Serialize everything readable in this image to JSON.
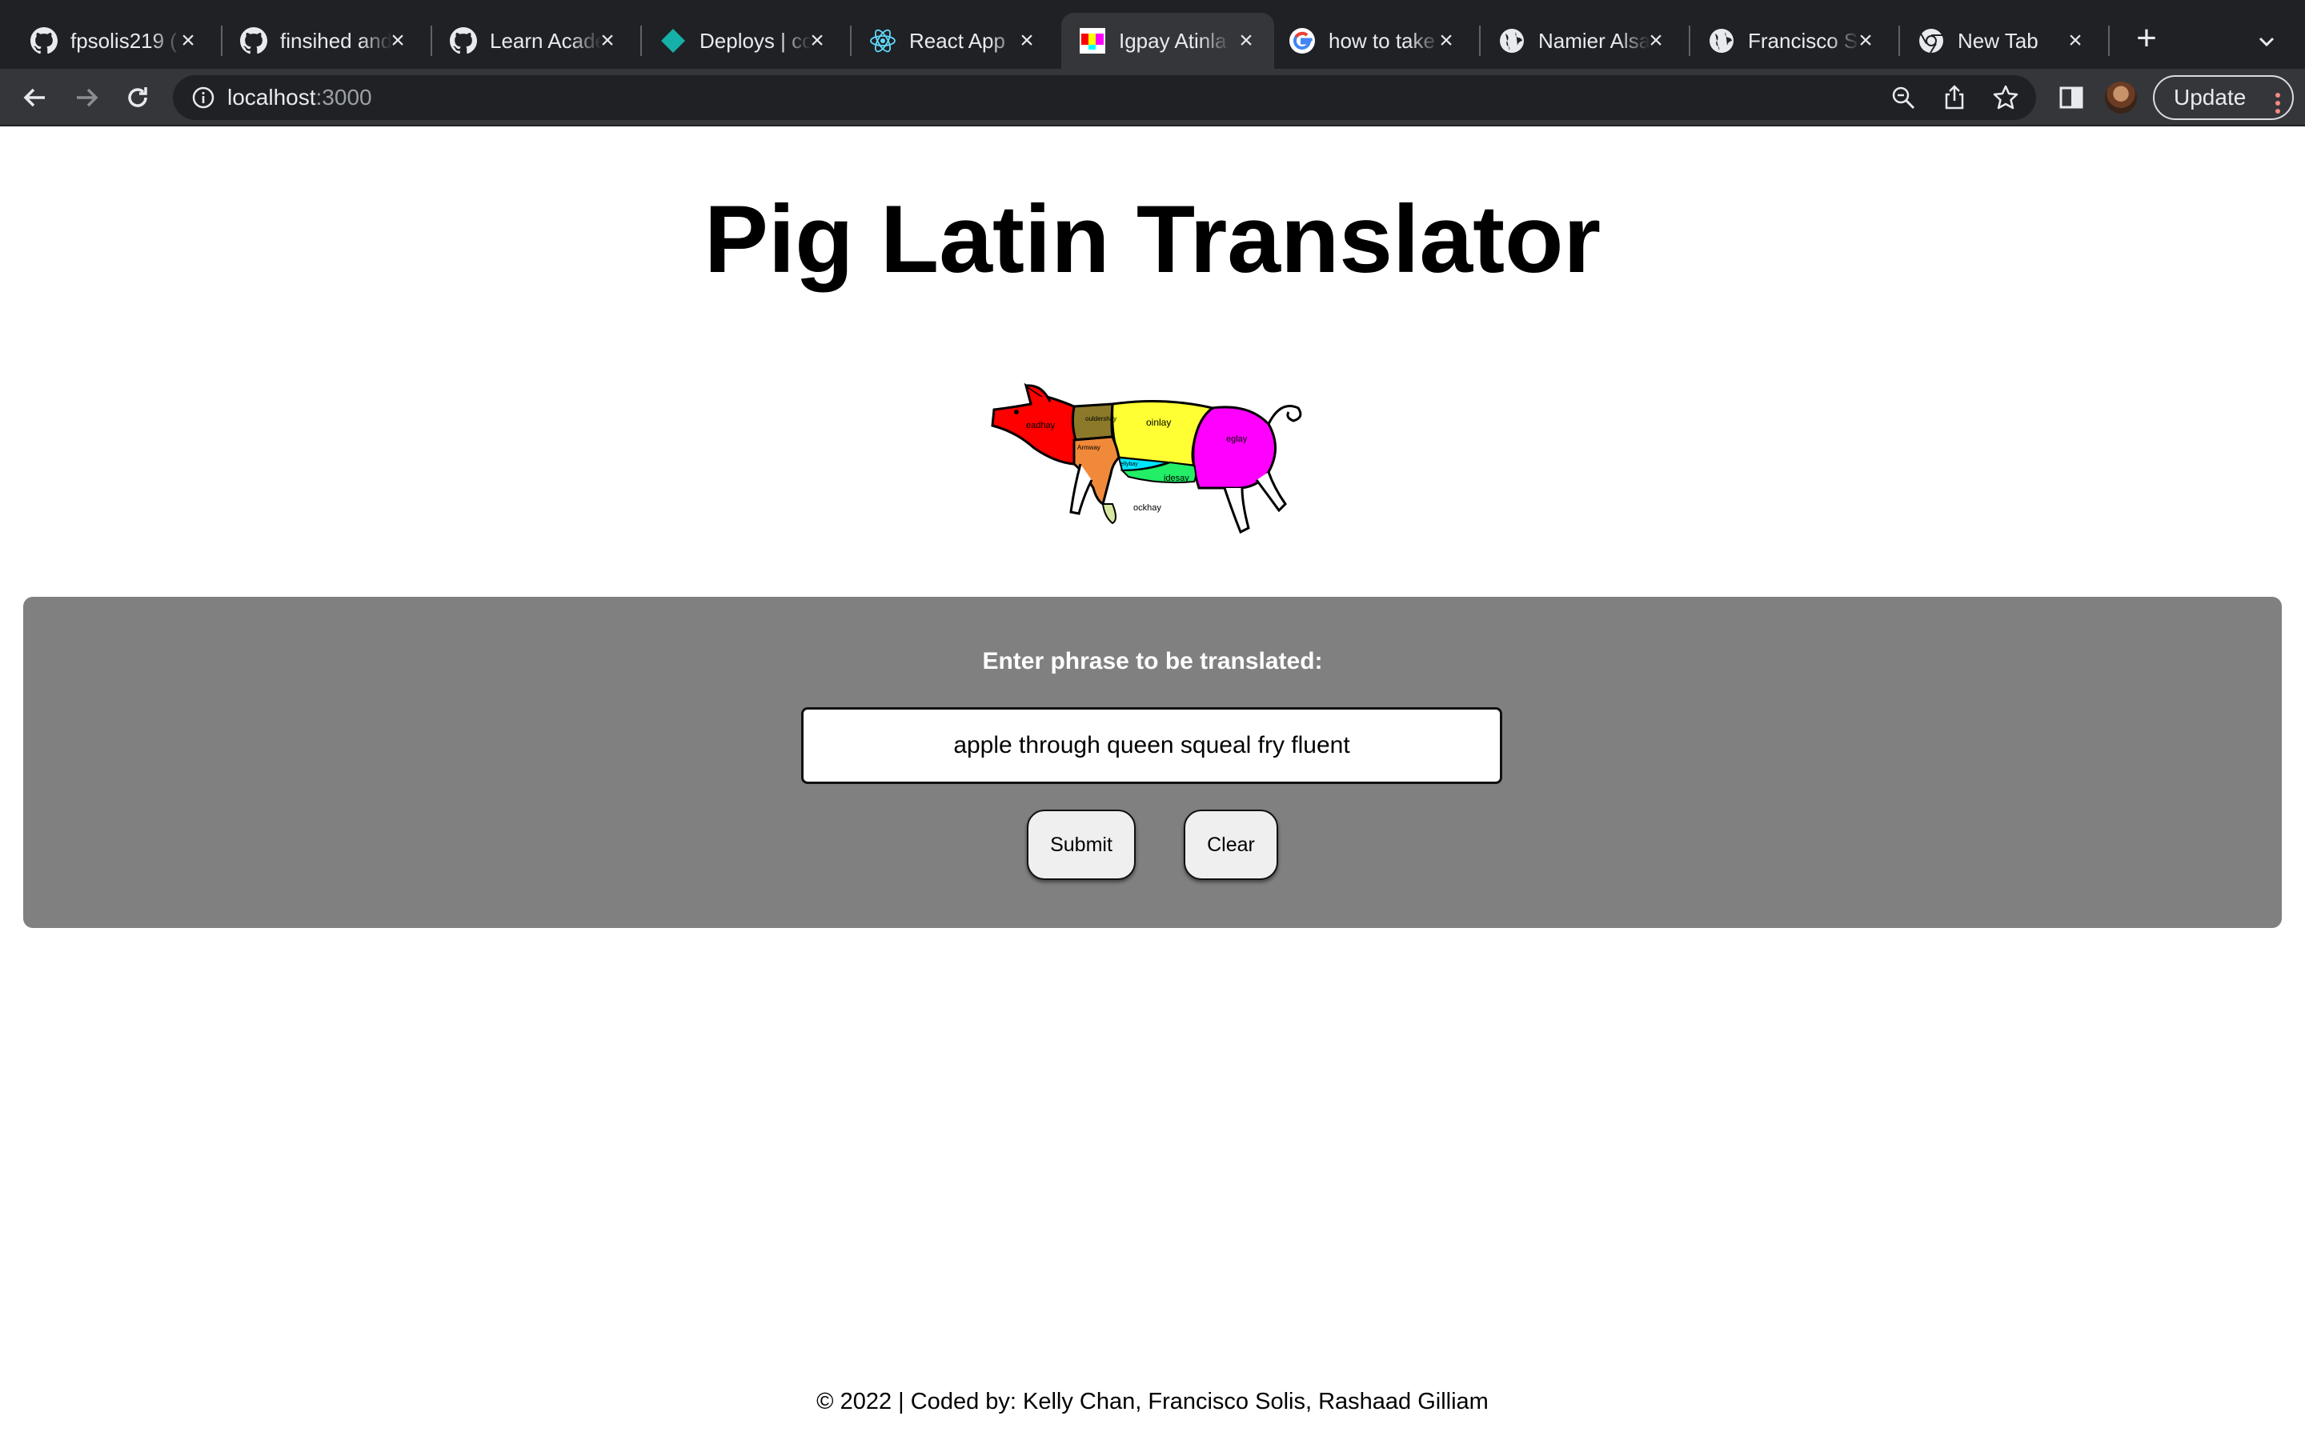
{
  "browser": {
    "tabs": [
      {
        "label": "fpsolis219 (",
        "icon": "github-icon"
      },
      {
        "label": "finsihed and",
        "icon": "github-icon"
      },
      {
        "label": "Learn Acade",
        "icon": "github-icon"
      },
      {
        "label": "Deploys | co",
        "icon": "netlify-icon"
      },
      {
        "label": "React App",
        "icon": "react-icon"
      },
      {
        "label": "Igpay Atinla",
        "icon": "pig-favicon-icon",
        "active": true
      },
      {
        "label": "how to take",
        "icon": "google-icon"
      },
      {
        "label": "Namier Alsa",
        "icon": "globe-icon"
      },
      {
        "label": "Francisco S",
        "icon": "globe-icon"
      },
      {
        "label": "New Tab",
        "icon": "chrome-icon"
      }
    ],
    "url_host": "localhost",
    "url_port": ":3000",
    "update_label": "Update",
    "colors": {
      "tabstrip": "#202124",
      "toolbar": "#35363a",
      "omnibox": "#202124"
    }
  },
  "page": {
    "title": "Pig Latin Translator",
    "pig_labels": {
      "head": "eadhay",
      "shoulder": "ouldershay",
      "loin": "oinlay",
      "leg": "eglay",
      "arm": "Armway",
      "belly": "ellybay",
      "side": "idesay",
      "hock": "ockhay"
    },
    "prompt": "Enter phrase to be translated:",
    "input_value": "apple through queen squeal fry fluent",
    "submit_label": "Submit",
    "clear_label": "Clear",
    "footer": "© 2022 | Coded by: Kelly Chan, Francisco Solis, Rashaad Gilliam",
    "colors": {
      "panel": "#808080",
      "button": "#efefef"
    }
  }
}
